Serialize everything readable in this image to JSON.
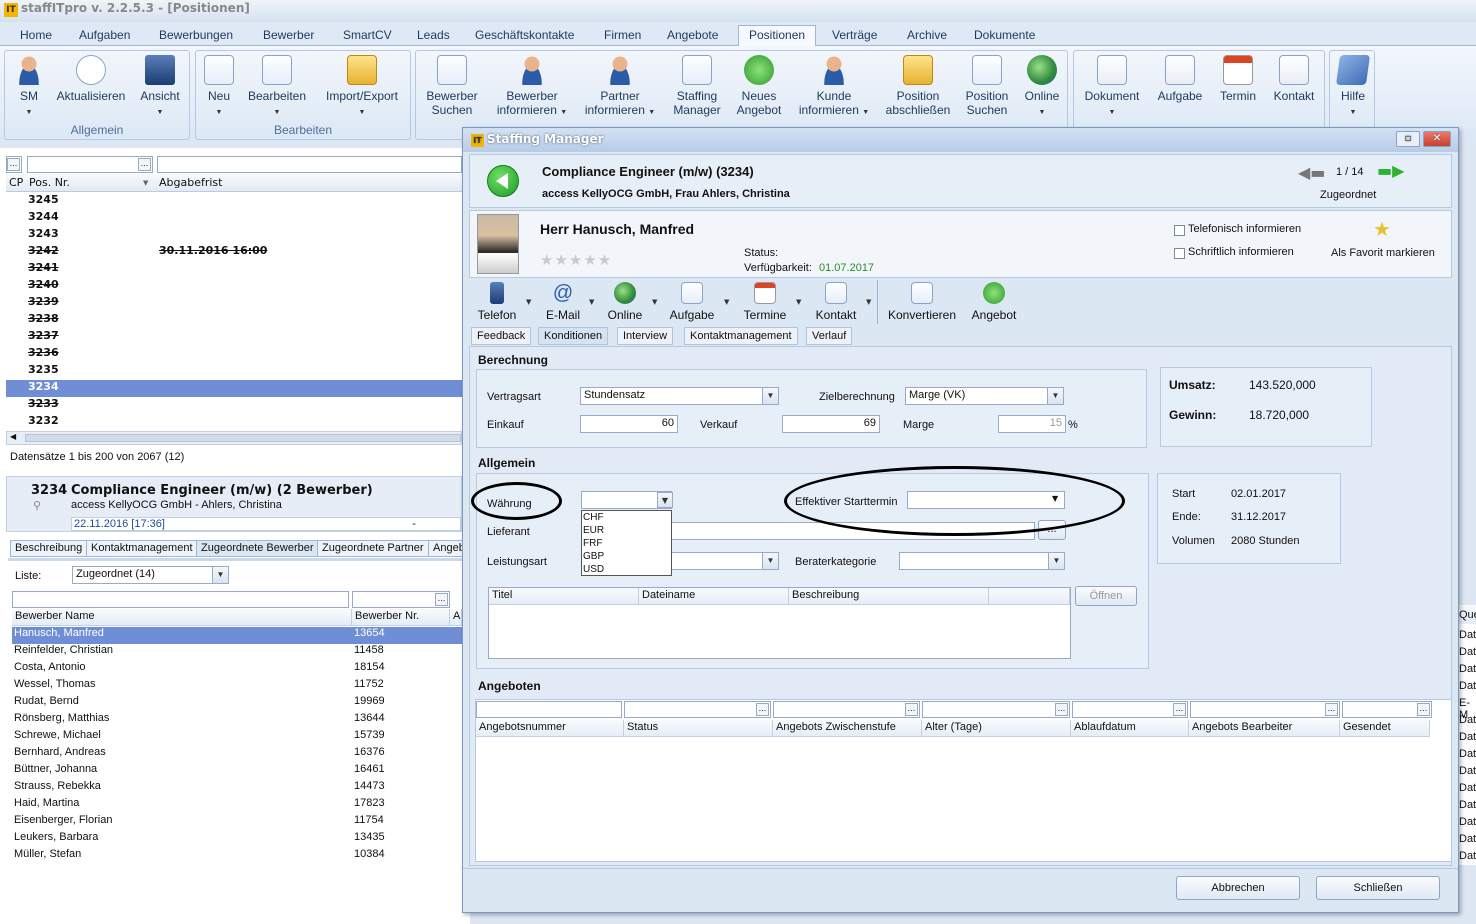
{
  "app": {
    "logo": "IT",
    "title": "staffITpro v. 2.2.5.3 - [Positionen]"
  },
  "menu": {
    "tabs": [
      "Home",
      "Aufgaben",
      "Bewerbungen",
      "Bewerber",
      "SmartCV",
      "Leads",
      "Geschäftskontakte",
      "Firmen",
      "Angebote",
      "Positionen",
      "Verträge",
      "Archive",
      "Dokumente"
    ],
    "active": "Positionen"
  },
  "ribbon": {
    "allgemein": {
      "name": "Allgemein",
      "buttons": [
        "SM",
        "Aktualisieren",
        "Ansicht"
      ]
    },
    "bearbeiten": {
      "name": "Bearbeiten",
      "buttons": [
        "Neu",
        "Bearbeiten",
        "Import/Export"
      ]
    },
    "positions": {
      "buttons": [
        [
          "Bewerber",
          "Suchen"
        ],
        [
          "Bewerber",
          "informieren"
        ],
        [
          "Partner",
          "informieren"
        ],
        [
          "Staffing",
          "Manager"
        ],
        [
          "Neues",
          "Angebot"
        ],
        [
          "Kunde",
          "informieren"
        ],
        [
          "Position",
          "abschließen"
        ],
        [
          "Position",
          "Suchen"
        ],
        [
          "Online",
          ""
        ]
      ]
    },
    "extra": {
      "buttons": [
        "Dokument",
        "Aufgabe",
        "Termin",
        "Kontakt"
      ]
    },
    "help": {
      "button": "Hilfe"
    }
  },
  "positions_list": {
    "headers": {
      "cp": "CP",
      "nr": "Pos. Nr.",
      "deadline": "Abgabefrist"
    },
    "rows": [
      {
        "nr": "3245",
        "deadline": "",
        "strike": false
      },
      {
        "nr": "3244",
        "deadline": "",
        "strike": false
      },
      {
        "nr": "3243",
        "deadline": "",
        "strike": false
      },
      {
        "nr": "3242",
        "deadline": "30.11.2016 16:00",
        "strike": true
      },
      {
        "nr": "3241",
        "deadline": "",
        "strike": true
      },
      {
        "nr": "3240",
        "deadline": "",
        "strike": true
      },
      {
        "nr": "3239",
        "deadline": "",
        "strike": true
      },
      {
        "nr": "3238",
        "deadline": "",
        "strike": true
      },
      {
        "nr": "3237",
        "deadline": "",
        "strike": true
      },
      {
        "nr": "3236",
        "deadline": "",
        "strike": true
      },
      {
        "nr": "3235",
        "deadline": "",
        "strike": false
      },
      {
        "nr": "3234",
        "deadline": "",
        "strike": false,
        "selected": true
      },
      {
        "nr": "3233",
        "deadline": "",
        "strike": true
      },
      {
        "nr": "3232",
        "deadline": "",
        "strike": false
      }
    ],
    "status": "Datensätze 1 bis 200 von 2067 (12)"
  },
  "position_detail": {
    "nr": "3234",
    "title": "Compliance Engineer (m/w) (2 Bewerber)",
    "customer": "access KellyOCG GmbH - Ahlers, Christina",
    "date": "22.11.2016 [17:36]",
    "dash": "-",
    "tabs": [
      "Beschreibung",
      "Kontaktmanagement",
      "Zugeordnete Bewerber",
      "Zugeordnete Partner",
      "Angeb"
    ],
    "active_tab": "Zugeordnete Bewerber",
    "liste_label": "Liste:",
    "liste_value": "Zugeordnet (14)",
    "grid_headers": [
      "Bewerber Name",
      "Bewerber Nr.",
      "A"
    ],
    "applicants": [
      {
        "name": "Hanusch, Manfred",
        "nr": "13654",
        "sel": true
      },
      {
        "name": "Reinfelder, Christian",
        "nr": "11458"
      },
      {
        "name": "Costa, Antonio",
        "nr": "18154"
      },
      {
        "name": "Wessel, Thomas",
        "nr": "11752"
      },
      {
        "name": "Rudat, Bernd",
        "nr": "19969"
      },
      {
        "name": "Rönsberg, Matthias",
        "nr": "13644"
      },
      {
        "name": "Schrewe, Michael",
        "nr": "15739"
      },
      {
        "name": "Bernhard, Andreas",
        "nr": "16376"
      },
      {
        "name": "Büttner, Johanna",
        "nr": "16461"
      },
      {
        "name": "Strauss, Rebekka",
        "nr": "14473"
      },
      {
        "name": "Haid, Martina",
        "nr": "17823"
      },
      {
        "name": "Eisenberger, Florian",
        "nr": "11754"
      },
      {
        "name": "Leukers, Barbara",
        "nr": "13435"
      },
      {
        "name": "Müller, Stefan",
        "nr": "10384"
      }
    ],
    "right_col": {
      "header": "Que",
      "values": [
        "Dat",
        "Dat",
        "Dat",
        "Dat",
        "E-M",
        "Dat",
        "Dat",
        "Dat",
        "Dat",
        "Dat",
        "Dat",
        "Dat",
        "Dat",
        "Dat"
      ]
    }
  },
  "dialog": {
    "title": "Staffing Manager",
    "job_title": "Compliance Engineer (m/w) (3234)",
    "company": "access KellyOCG GmbH, Frau Ahlers, Christina",
    "pager": "1 / 14",
    "pager_status": "Zugeordnet",
    "candidate": {
      "name": "Herr Hanusch, Manfred",
      "status_label": "Status:",
      "avail_label": "Verfügbarkeit:",
      "avail_value": "01.07.2017",
      "rating": 0
    },
    "check_phone": "Telefonisch informieren",
    "check_written": "Schriftlich informieren",
    "favorite": "Als Favorit markieren",
    "toolbar": [
      "Telefon",
      "E-Mail",
      "Online",
      "Aufgabe",
      "Termine",
      "Kontakt",
      "Konvertieren",
      "Angebot"
    ],
    "tabs": [
      "Feedback",
      "Konditionen",
      "Interview",
      "Kontaktmanagement",
      "Verlauf"
    ],
    "active_tab": "Konditionen",
    "berechnung": {
      "section": "Berechnung",
      "vertragsart_label": "Vertragsart",
      "vertragsart": "Stundensatz",
      "ziel_label": "Zielberechnung",
      "ziel": "Marge (VK)",
      "einkauf_label": "Einkauf",
      "einkauf": "60",
      "verkauf_label": "Verkauf",
      "verkauf": "69",
      "marge_label": "Marge",
      "marge": "15",
      "percent": "%"
    },
    "totals": {
      "umsatz_label": "Umsatz:",
      "umsatz": "143.520,000",
      "gewinn_label": "Gewinn:",
      "gewinn": "18.720,000"
    },
    "allgemein": {
      "section": "Allgemein",
      "waehrung_label": "Währung",
      "waehrung": "",
      "currencies": [
        "CHF",
        "EUR",
        "FRF",
        "GBP",
        "USD"
      ],
      "start_label": "Effektiver Starttermin",
      "start": "",
      "lieferant_label": "Lieferant",
      "leistungsart_label": "Leistungsart",
      "berater_label": "Beraterkategorie",
      "ellipsis": "...",
      "doc_headers": [
        "Titel",
        "Dateiname",
        "Beschreibung"
      ],
      "open": "Öffnen"
    },
    "period": {
      "start_label": "Start",
      "start": "02.01.2017",
      "ende_label": "Ende:",
      "ende": "31.12.2017",
      "volumen_label": "Volumen",
      "volumen": "2080 Stunden"
    },
    "angeboten": {
      "section": "Angeboten",
      "headers": [
        "Angebotsnummer",
        "Status",
        "Angebots Zwischenstufe",
        "Alter (Tage)",
        "Ablaufdatum",
        "Angebots Bearbeiter",
        "Gesendet"
      ]
    },
    "buttons": {
      "cancel": "Abbrechen",
      "close": "Schließen"
    }
  }
}
